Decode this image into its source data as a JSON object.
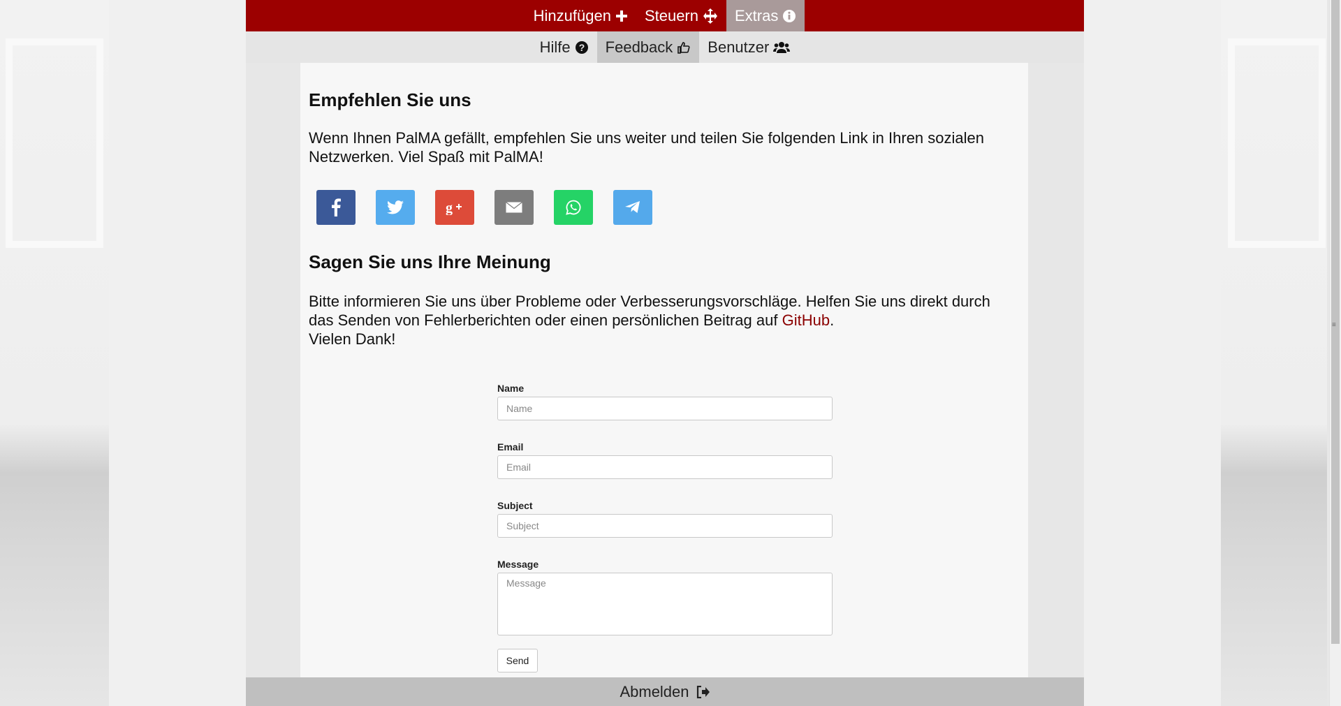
{
  "nav": {
    "top": [
      {
        "label": "Hinzufügen",
        "icon": "plus-icon"
      },
      {
        "label": "Steuern",
        "icon": "move-arrows-icon"
      },
      {
        "label": "Extras",
        "icon": "info-circle-icon",
        "active": true
      }
    ],
    "sub": [
      {
        "label": "Hilfe",
        "icon": "question-circle-icon"
      },
      {
        "label": "Feedback",
        "icon": "thumbs-up-icon",
        "active": true
      },
      {
        "label": "Benutzer",
        "icon": "users-icon"
      }
    ]
  },
  "recommend": {
    "title": "Empfehlen Sie uns",
    "text": "Wenn Ihnen PalMA gefällt, empfehlen Sie uns weiter und teilen Sie folgenden Link in Ihren sozialen Netzwerken. Viel Spaß mit PalMA!"
  },
  "social": [
    {
      "name": "facebook",
      "icon": "facebook-icon",
      "color": "#3b5998"
    },
    {
      "name": "twitter",
      "icon": "twitter-icon",
      "color": "#55acee"
    },
    {
      "name": "google-plus",
      "icon": "google-plus-icon",
      "color": "#dd4b39"
    },
    {
      "name": "email",
      "icon": "email-icon",
      "color": "#7d7d7d"
    },
    {
      "name": "whatsapp",
      "icon": "whatsapp-icon",
      "color": "#25d366"
    },
    {
      "name": "telegram",
      "icon": "telegram-icon",
      "color": "#54a9eb"
    }
  ],
  "opinion": {
    "title": "Sagen Sie uns Ihre Meinung",
    "text_before": "Bitte informieren Sie uns über Probleme oder Verbesserungsvorschläge. Helfen Sie uns direkt durch das Senden von Fehlerberichten oder einen persönlichen Beitrag auf ",
    "link": "GitHub",
    "text_after": ".",
    "thanks": "Vielen Dank!"
  },
  "form": {
    "name": {
      "label": "Name",
      "placeholder": "Name",
      "value": ""
    },
    "email": {
      "label": "Email",
      "placeholder": "Email",
      "value": ""
    },
    "subject": {
      "label": "Subject",
      "placeholder": "Subject",
      "value": ""
    },
    "message": {
      "label": "Message",
      "placeholder": "Message",
      "value": ""
    },
    "send_label": "Send"
  },
  "footer": {
    "logout_label": "Abmelden",
    "icon": "sign-out-icon"
  },
  "colors": {
    "brand": "#9c0000",
    "link": "#8b0000"
  }
}
